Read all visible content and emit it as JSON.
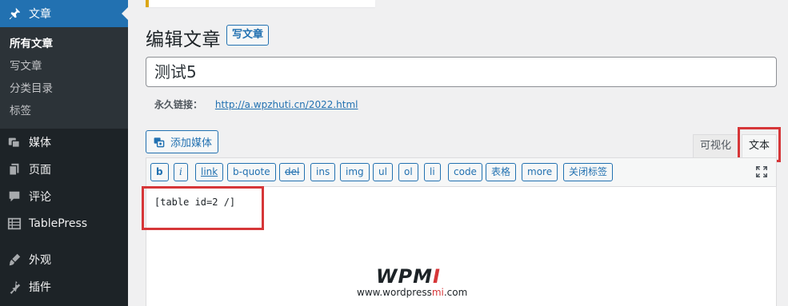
{
  "sidebar": {
    "posts": {
      "label": "文章",
      "icon": "pin-icon"
    },
    "submenu": [
      {
        "label": "所有文章",
        "current": true
      },
      {
        "label": "写文章",
        "current": false
      },
      {
        "label": "分类目录",
        "current": false
      },
      {
        "label": "标签",
        "current": false
      }
    ],
    "media": {
      "label": "媒体",
      "icon": "media-icon"
    },
    "pages": {
      "label": "页面",
      "icon": "page-icon"
    },
    "comments": {
      "label": "评论",
      "icon": "comment-icon"
    },
    "tablepress": {
      "label": "TablePress",
      "icon": "table-icon"
    },
    "appearance": {
      "label": "外观",
      "icon": "paintbrush-icon"
    },
    "plugins": {
      "label": "插件",
      "icon": "plugin-icon"
    }
  },
  "header": {
    "title": "编辑文章",
    "add_new": "写文章"
  },
  "post": {
    "title": "测试5",
    "permalink_label": "永久链接：",
    "permalink_url": "http://a.wpzhuti.cn/2022.html"
  },
  "editor": {
    "add_media": "添加媒体",
    "tabs": {
      "visual": "可视化",
      "text": "文本"
    },
    "quicktags": [
      "b",
      "i",
      "link",
      "b-quote",
      "del",
      "ins",
      "img",
      "ul",
      "ol",
      "li",
      "code",
      "表格",
      "more",
      "关闭标签"
    ],
    "content": "[table id=2 /]"
  },
  "watermark": {
    "logo_main": "WPM",
    "logo_accent": "I",
    "url_prefix": "www.wordpress",
    "url_accent": "mi",
    "url_suffix": ".com"
  },
  "colors": {
    "sidebar_bg": "#1d2327",
    "accent": "#2271b1",
    "highlight": "#d63638"
  }
}
